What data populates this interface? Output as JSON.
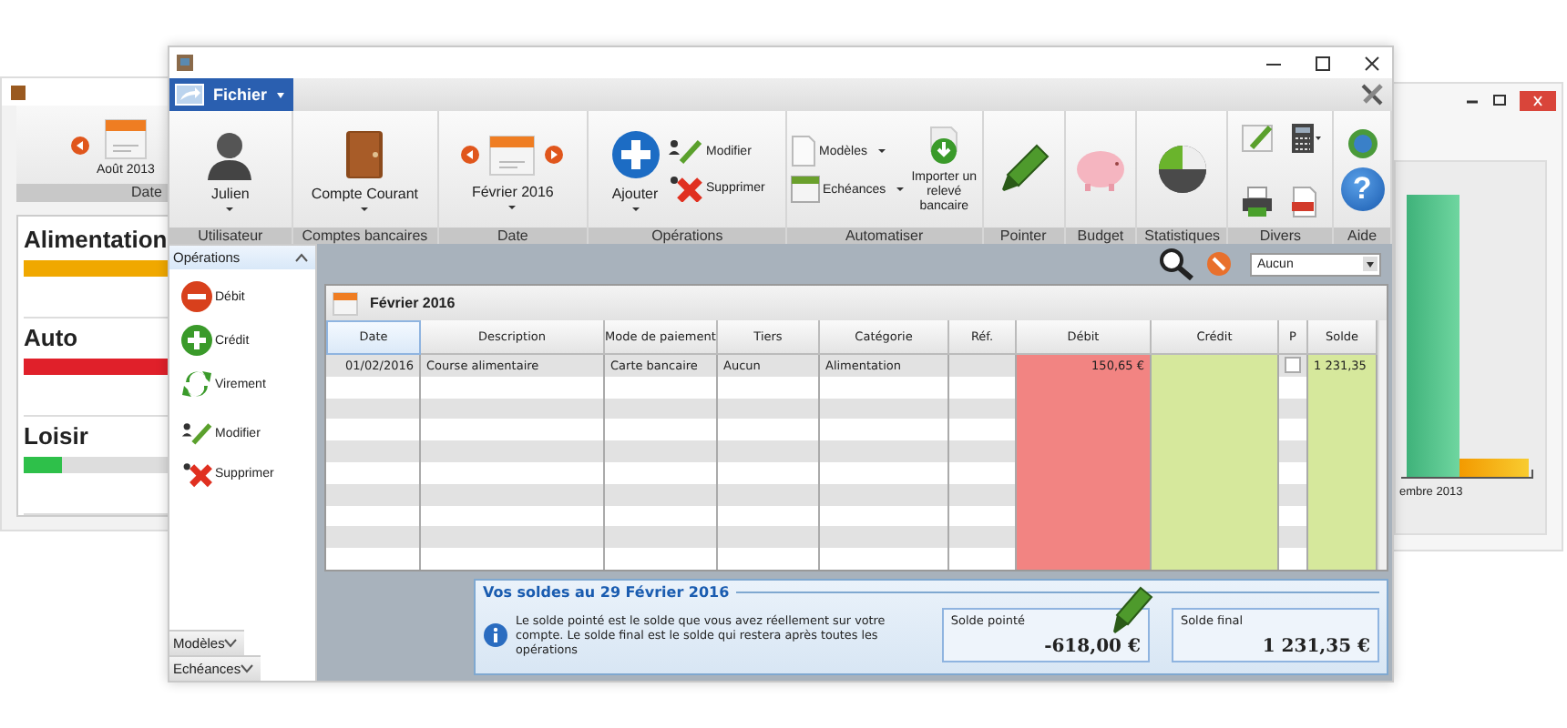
{
  "back_left": {
    "date": "Août 2013",
    "group": "Date",
    "budgets": [
      {
        "name": "Alimentation",
        "level": 1,
        "color": "#f0a800"
      },
      {
        "name": "Auto",
        "level": 1,
        "color": "#e0202a"
      },
      {
        "name": "Loisir",
        "level": 0.25,
        "color": "#2ec04a"
      }
    ]
  },
  "back_right": {
    "axis_label": "embre 2013"
  },
  "main": {
    "menu_button": "Fichier",
    "ribbon": [
      {
        "label": "Utilisateur",
        "items": [
          "Julien"
        ]
      },
      {
        "label": "Comptes bancaires",
        "items": [
          "Compte Courant"
        ]
      },
      {
        "label": "Date",
        "items": [
          "Février 2016"
        ]
      },
      {
        "label": "Opérations",
        "items": [
          "Ajouter",
          "Modifier",
          "Supprimer"
        ]
      },
      {
        "label": "Automatiser",
        "items": [
          "Modèles",
          "Echéances",
          "Importer un relevé bancaire"
        ]
      },
      {
        "label": "Pointer"
      },
      {
        "label": "Budget"
      },
      {
        "label": "Statistiques"
      },
      {
        "label": "Divers"
      },
      {
        "label": "Aide",
        "items": [
          "?"
        ]
      }
    ],
    "sidebar": [
      {
        "title": "Opérations",
        "expanded": true,
        "items": [
          "Débit",
          "Crédit",
          "Virement",
          "Modifier",
          "Supprimer"
        ]
      },
      {
        "title": "Modèles",
        "expanded": false
      },
      {
        "title": "Echéances",
        "expanded": false
      }
    ],
    "filter": {
      "value": "Aucun"
    },
    "table": {
      "title": "Février 2016",
      "columns": [
        {
          "label": "Date",
          "selected": true
        },
        {
          "label": "Description",
          "selected": false
        },
        {
          "label": "Mode de paiement",
          "selected": false
        },
        {
          "label": "Tiers",
          "selected": false
        },
        {
          "label": "Catégorie",
          "selected": false
        },
        {
          "label": "Réf.",
          "selected": false
        },
        {
          "label": "Débit",
          "selected": false
        },
        {
          "label": "Crédit",
          "selected": false
        },
        {
          "label": "P",
          "selected": false
        },
        {
          "label": "Solde",
          "selected": false
        }
      ],
      "rows": [
        {
          "date": "01/02/2016",
          "description": "Course alimentaire",
          "payment": "Carte bancaire",
          "payee": "Aucun",
          "category": "Alimentation",
          "debit": "150,65 €",
          "checked": false,
          "balance": "1 231,35"
        }
      ]
    },
    "balances": {
      "title": "Vos soldes au 29 Février 2016",
      "info": "Le solde pointé est le solde que vous avez réellement sur votre compte. Le solde final est le solde qui restera après toutes les opérations",
      "items": [
        {
          "label": "Solde pointé",
          "value": "-618,00 €"
        },
        {
          "label": "Solde final",
          "value": "1 231,35 €"
        }
      ]
    }
  }
}
